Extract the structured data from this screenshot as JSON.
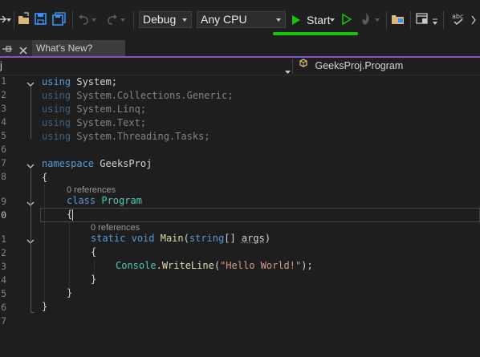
{
  "toolbar": {
    "config": "Debug",
    "platform": "Any CPU",
    "start": "Start"
  },
  "tabs": {
    "whats_new": "What's New?"
  },
  "navbar": {
    "left": "j",
    "class_name": "GeeksProj.Program"
  },
  "editor": {
    "line_numbers": [
      "1",
      "2",
      "3",
      "4",
      "5",
      "6",
      "7",
      "8",
      "9",
      "0",
      "1",
      "2",
      "3",
      "4",
      "5",
      "6",
      "7"
    ],
    "references": "0 references",
    "usings": [
      {
        "kw": "using",
        "ns": "System;"
      },
      {
        "kw": "using",
        "ns": "System.Collections.Generic;"
      },
      {
        "kw": "using",
        "ns": "System.Linq;"
      },
      {
        "kw": "using",
        "ns": "System.Text;"
      },
      {
        "kw": "using",
        "ns": "System.Threading.Tasks;"
      }
    ],
    "namespace_kw": "namespace",
    "namespace_name": "GeeksProj",
    "open_brace": "{",
    "close_brace": "}",
    "class_kw": "class",
    "class_name": "Program",
    "method_static": "static",
    "method_void": "void",
    "method_name": "Main",
    "param_type": "string",
    "param_brackets": "[]",
    "param_name": "args",
    "console": "Console",
    "writeline": "WriteLine",
    "string_literal": "\"Hello World!\"",
    "statement_end": ");"
  },
  "colors": {
    "keyword": "#569cd6",
    "type": "#4ec9b0",
    "method": "#dcdcaa",
    "string": "#d69d85",
    "start_green": "#16c60c",
    "accent": "#7e57c2"
  }
}
